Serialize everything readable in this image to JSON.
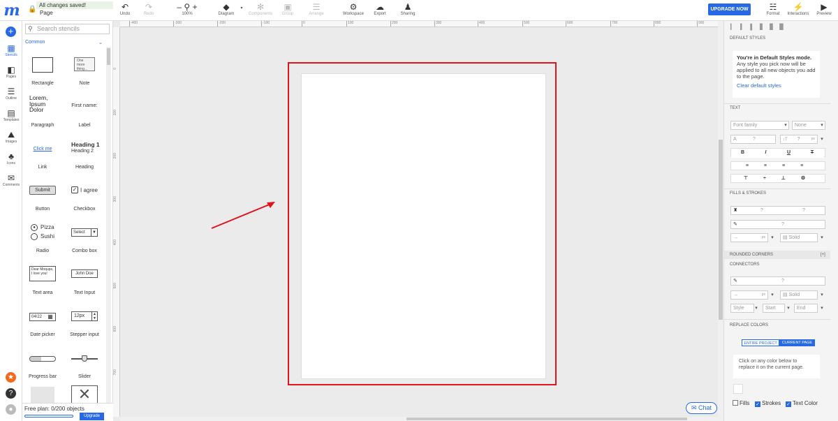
{
  "header": {
    "status": "All changes saved!",
    "page": "Page",
    "tools": {
      "undo": "Undo",
      "redo": "Redo",
      "zoom": "100%",
      "diagram": "Diagram",
      "components": "Components",
      "group": "Group",
      "arrange": "Arrange",
      "workspace": "Workspace",
      "export": "Export",
      "sharing": "Sharing",
      "format": "Format",
      "interactions": "Interactions",
      "preview": "Preview"
    },
    "upgrade": "UPGRADE NOW"
  },
  "nav": {
    "stencils": "Stencils",
    "pages": "Pages",
    "outline": "Outline",
    "templates": "Templates",
    "images": "Images",
    "icons": "Icons",
    "comments": "Comments"
  },
  "stencils": {
    "search_placeholder": "Search stencils",
    "category": "Common",
    "items": [
      {
        "label": "Rectangle"
      },
      {
        "label": "Note",
        "preview": "One more thing..."
      },
      {
        "label": "Paragraph",
        "preview": "Lorem, Ipsum Dolor"
      },
      {
        "label": "Label",
        "preview": "First name:"
      },
      {
        "label": "Link",
        "preview": "Click me"
      },
      {
        "label": "Heading",
        "preview": "Heading 1",
        "preview2": "Heading 2"
      },
      {
        "label": "Button",
        "preview": "Submit"
      },
      {
        "label": "Checkbox",
        "preview": "I agree"
      },
      {
        "label": "Radio",
        "preview": "Pizza",
        "preview2": "Sushi"
      },
      {
        "label": "Combo box",
        "preview": "Select"
      },
      {
        "label": "Text area",
        "preview": "Dear Moqups, I love you!"
      },
      {
        "label": "Text Input",
        "preview": "John Doe"
      },
      {
        "label": "Date picker",
        "preview": "04/22"
      },
      {
        "label": "Stepper input",
        "preview": "12px"
      },
      {
        "label": "Progress bar"
      },
      {
        "label": "Slider"
      }
    ],
    "free_plan": "Free plan: 0/200 objects",
    "upgrade": "Upgrade"
  },
  "ruler": {
    "h": [
      "-400",
      "-300",
      "-200",
      "-100",
      "0",
      "100",
      "200",
      "300",
      "400",
      "500",
      "600",
      "700",
      "800",
      "900"
    ],
    "v": [
      "0",
      "100",
      "200",
      "300",
      "400",
      "500",
      "600",
      "700"
    ]
  },
  "chat": "Chat",
  "panel": {
    "default_styles": {
      "title": "DEFAULT STYLES",
      "heading": "You're in Default Styles mode.",
      "body": "Any style you pick now will be applied to all new objects you add to the page.",
      "link": "Clear default styles"
    },
    "text": {
      "title": "TEXT",
      "font_family": "Font family",
      "weight": "None",
      "size_a": "A",
      "size_q": "?",
      "line_q": "?",
      "px1": "px",
      "px2": "px",
      "bold": "B",
      "italic": "I",
      "underline": "U",
      "strike": "T"
    },
    "fills": {
      "title": "FILLS & STROKES",
      "fill_q1": "?",
      "fill_q2": "?",
      "stroke_q": "?",
      "px": "px",
      "style": "Solid"
    },
    "rounded": {
      "title": "ROUNDED CORNERS",
      "toggle": "[+]"
    },
    "connectors": {
      "title": "CONNECTORS",
      "stroke_q": "?",
      "px": "px",
      "style": "Solid",
      "line_style": "Style",
      "start": "Start",
      "end": "End"
    },
    "replace": {
      "title": "REPLACE COLORS",
      "entire": "ENTIRE PROJECT",
      "current": "CURRENT PAGE",
      "hint": "Click on any color below to replace it on the current page.",
      "fills": "Fills",
      "strokes": "Strokes",
      "text_color": "Text Color"
    }
  },
  "colors": {
    "accent": "#2769e4",
    "highlight": "#e0141c"
  }
}
